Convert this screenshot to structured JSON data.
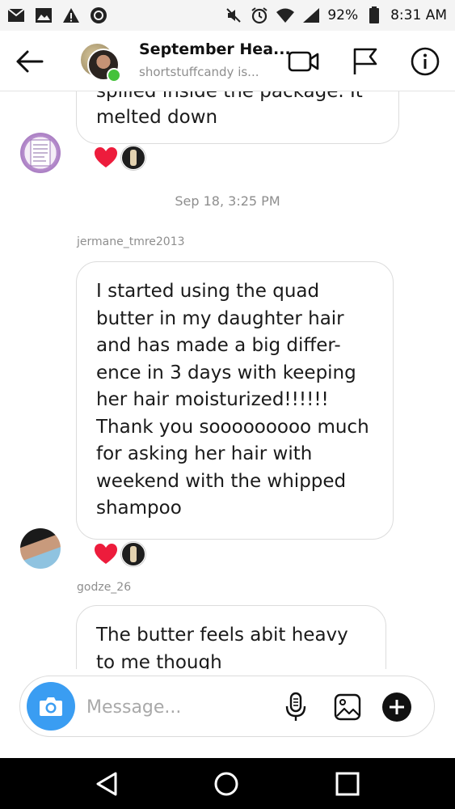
{
  "status_bar": {
    "battery": "92%",
    "time": "8:31 AM"
  },
  "header": {
    "title": "September Hea...",
    "subtitle": "shortstuffcandy is..."
  },
  "messages": [
    {
      "partial_top": "spilled inside the package. It",
      "text": "melted down",
      "reactions": [
        "heart-icon",
        "reactor-avatar"
      ]
    },
    {
      "timestamp": "Sep 18, 3:25 PM",
      "username": "jermane_tmre2013",
      "lines": [
        "I started using the quad",
        "butter in my daughter hair",
        "and has made a big differ-",
        "ence in 3 days with keeping",
        "her hair moisturized!!!!!!",
        "Thank you sooooooooo much",
        "for asking her hair with",
        "weekend with the whipped",
        "shampoo"
      ],
      "reactions": [
        "heart-icon",
        "reactor-avatar"
      ]
    },
    {
      "username": "godze_26",
      "lines": [
        "The butter feels abit heavy",
        "to me though"
      ]
    }
  ],
  "composer": {
    "placeholder": "Message..."
  },
  "colors": {
    "accent_blue": "#3a9df2",
    "heart_red": "#ed1c3c",
    "online_green": "#44c23a",
    "muted_text": "#8e8e8e"
  }
}
